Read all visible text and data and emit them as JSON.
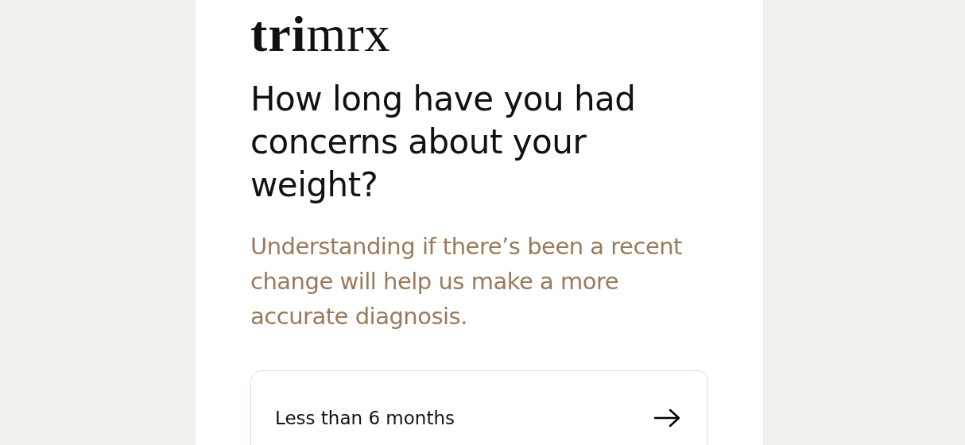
{
  "logo": "**tri**mrx",
  "question": {
    "title": "How long have you had concerns about your weight?",
    "subtitle": "Understanding if there’s been a recent change will help us make a more accurate diagnosis."
  },
  "options": [
    {
      "label": "Less than 6 months"
    }
  ]
}
